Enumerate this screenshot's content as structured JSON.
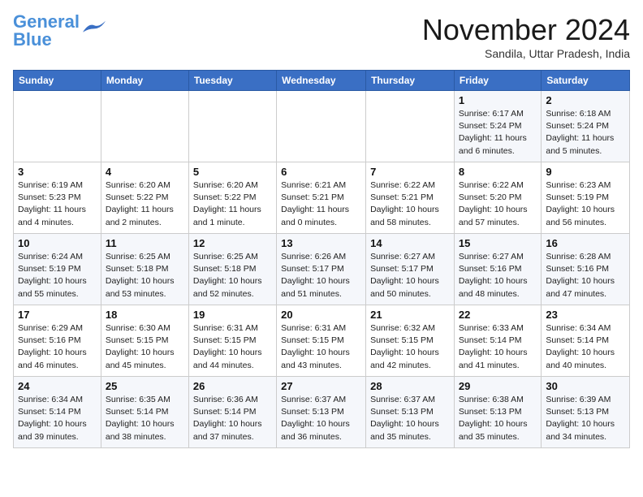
{
  "header": {
    "logo_line1": "General",
    "logo_line2": "Blue",
    "month": "November 2024",
    "location": "Sandila, Uttar Pradesh, India"
  },
  "weekdays": [
    "Sunday",
    "Monday",
    "Tuesday",
    "Wednesday",
    "Thursday",
    "Friday",
    "Saturday"
  ],
  "weeks": [
    [
      {
        "day": "",
        "info": ""
      },
      {
        "day": "",
        "info": ""
      },
      {
        "day": "",
        "info": ""
      },
      {
        "day": "",
        "info": ""
      },
      {
        "day": "",
        "info": ""
      },
      {
        "day": "1",
        "info": "Sunrise: 6:17 AM\nSunset: 5:24 PM\nDaylight: 11 hours\nand 6 minutes."
      },
      {
        "day": "2",
        "info": "Sunrise: 6:18 AM\nSunset: 5:24 PM\nDaylight: 11 hours\nand 5 minutes."
      }
    ],
    [
      {
        "day": "3",
        "info": "Sunrise: 6:19 AM\nSunset: 5:23 PM\nDaylight: 11 hours\nand 4 minutes."
      },
      {
        "day": "4",
        "info": "Sunrise: 6:20 AM\nSunset: 5:22 PM\nDaylight: 11 hours\nand 2 minutes."
      },
      {
        "day": "5",
        "info": "Sunrise: 6:20 AM\nSunset: 5:22 PM\nDaylight: 11 hours\nand 1 minute."
      },
      {
        "day": "6",
        "info": "Sunrise: 6:21 AM\nSunset: 5:21 PM\nDaylight: 11 hours\nand 0 minutes."
      },
      {
        "day": "7",
        "info": "Sunrise: 6:22 AM\nSunset: 5:21 PM\nDaylight: 10 hours\nand 58 minutes."
      },
      {
        "day": "8",
        "info": "Sunrise: 6:22 AM\nSunset: 5:20 PM\nDaylight: 10 hours\nand 57 minutes."
      },
      {
        "day": "9",
        "info": "Sunrise: 6:23 AM\nSunset: 5:19 PM\nDaylight: 10 hours\nand 56 minutes."
      }
    ],
    [
      {
        "day": "10",
        "info": "Sunrise: 6:24 AM\nSunset: 5:19 PM\nDaylight: 10 hours\nand 55 minutes."
      },
      {
        "day": "11",
        "info": "Sunrise: 6:25 AM\nSunset: 5:18 PM\nDaylight: 10 hours\nand 53 minutes."
      },
      {
        "day": "12",
        "info": "Sunrise: 6:25 AM\nSunset: 5:18 PM\nDaylight: 10 hours\nand 52 minutes."
      },
      {
        "day": "13",
        "info": "Sunrise: 6:26 AM\nSunset: 5:17 PM\nDaylight: 10 hours\nand 51 minutes."
      },
      {
        "day": "14",
        "info": "Sunrise: 6:27 AM\nSunset: 5:17 PM\nDaylight: 10 hours\nand 50 minutes."
      },
      {
        "day": "15",
        "info": "Sunrise: 6:27 AM\nSunset: 5:16 PM\nDaylight: 10 hours\nand 48 minutes."
      },
      {
        "day": "16",
        "info": "Sunrise: 6:28 AM\nSunset: 5:16 PM\nDaylight: 10 hours\nand 47 minutes."
      }
    ],
    [
      {
        "day": "17",
        "info": "Sunrise: 6:29 AM\nSunset: 5:16 PM\nDaylight: 10 hours\nand 46 minutes."
      },
      {
        "day": "18",
        "info": "Sunrise: 6:30 AM\nSunset: 5:15 PM\nDaylight: 10 hours\nand 45 minutes."
      },
      {
        "day": "19",
        "info": "Sunrise: 6:31 AM\nSunset: 5:15 PM\nDaylight: 10 hours\nand 44 minutes."
      },
      {
        "day": "20",
        "info": "Sunrise: 6:31 AM\nSunset: 5:15 PM\nDaylight: 10 hours\nand 43 minutes."
      },
      {
        "day": "21",
        "info": "Sunrise: 6:32 AM\nSunset: 5:15 PM\nDaylight: 10 hours\nand 42 minutes."
      },
      {
        "day": "22",
        "info": "Sunrise: 6:33 AM\nSunset: 5:14 PM\nDaylight: 10 hours\nand 41 minutes."
      },
      {
        "day": "23",
        "info": "Sunrise: 6:34 AM\nSunset: 5:14 PM\nDaylight: 10 hours\nand 40 minutes."
      }
    ],
    [
      {
        "day": "24",
        "info": "Sunrise: 6:34 AM\nSunset: 5:14 PM\nDaylight: 10 hours\nand 39 minutes."
      },
      {
        "day": "25",
        "info": "Sunrise: 6:35 AM\nSunset: 5:14 PM\nDaylight: 10 hours\nand 38 minutes."
      },
      {
        "day": "26",
        "info": "Sunrise: 6:36 AM\nSunset: 5:14 PM\nDaylight: 10 hours\nand 37 minutes."
      },
      {
        "day": "27",
        "info": "Sunrise: 6:37 AM\nSunset: 5:13 PM\nDaylight: 10 hours\nand 36 minutes."
      },
      {
        "day": "28",
        "info": "Sunrise: 6:37 AM\nSunset: 5:13 PM\nDaylight: 10 hours\nand 35 minutes."
      },
      {
        "day": "29",
        "info": "Sunrise: 6:38 AM\nSunset: 5:13 PM\nDaylight: 10 hours\nand 35 minutes."
      },
      {
        "day": "30",
        "info": "Sunrise: 6:39 AM\nSunset: 5:13 PM\nDaylight: 10 hours\nand 34 minutes."
      }
    ]
  ]
}
